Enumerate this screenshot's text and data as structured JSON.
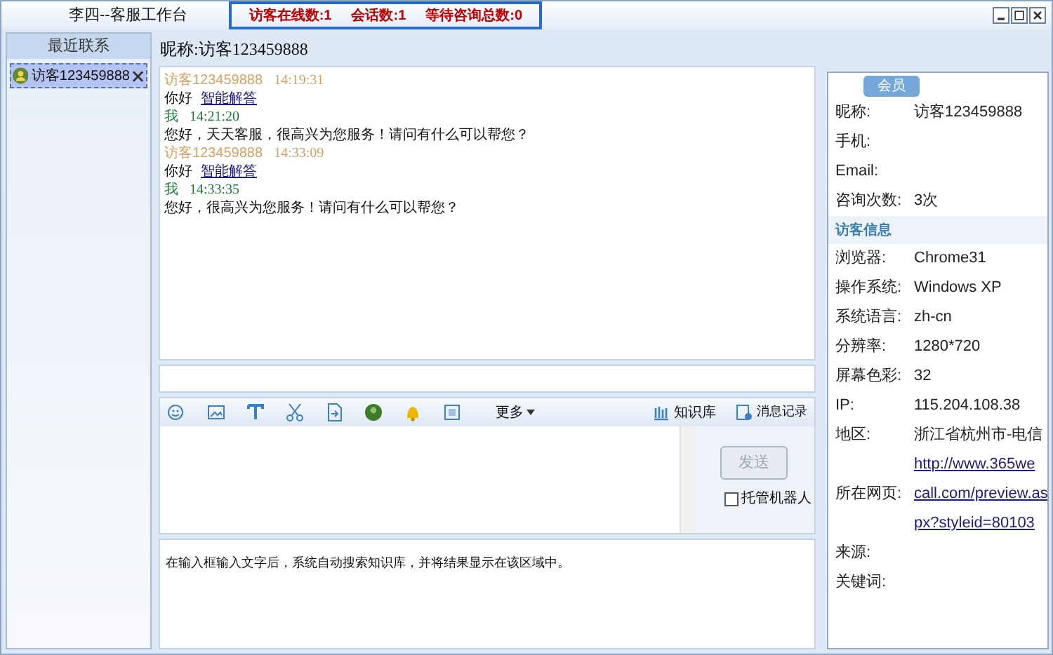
{
  "window": {
    "title": "李四--客服工作台"
  },
  "status": [
    "访客在线数:1",
    "会话数:1",
    "等待咨询总数:0"
  ],
  "sidebar": {
    "header": "最近联系",
    "items": [
      {
        "name": "访客123459888",
        "selected": true
      }
    ]
  },
  "chat": {
    "nickname": "昵称:访客123459888",
    "messages": [
      {
        "kind": "visitor",
        "sender": "访客123459888",
        "time": "14:19:31",
        "text": "你好",
        "link": "智能解答"
      },
      {
        "kind": "agent",
        "sender": "我",
        "time": "14:21:20",
        "text": "您好，天天客服，很高兴为您服务！请问有什么可以帮您？"
      },
      {
        "kind": "visitor",
        "sender": "访客123459888",
        "time": "14:33:09",
        "text": "你好",
        "link": "智能解答"
      },
      {
        "kind": "agent",
        "sender": "我",
        "time": "14:33:35",
        "text": "您好，很高兴为您服务！请问有什么可以帮您？"
      }
    ]
  },
  "toolbar": {
    "more": "更多",
    "knowledge": "知识库",
    "history": "消息记录"
  },
  "send": {
    "label": "发送",
    "disabled": true
  },
  "robot": {
    "label": "托管机器人",
    "checked": false
  },
  "hint": "在输入框输入文字后，系统自动搜索知识库，并将结果显示在该区域中。",
  "info": {
    "badge": "会员",
    "member_rows": [
      {
        "label": "昵称:",
        "value": "访客123459888"
      },
      {
        "label": "手机:"
      },
      {
        "label": "Email:"
      },
      {
        "label": "咨询次数:",
        "value": "3次"
      }
    ],
    "section": "访客信息",
    "visitor_rows": [
      {
        "label": "浏览器:",
        "value": "Chrome31"
      },
      {
        "label": "操作系统:",
        "value": "Windows XP"
      },
      {
        "label": "系统语言:",
        "value": "zh-cn"
      },
      {
        "label": "分辨率:",
        "value": "1280*720"
      },
      {
        "label": "屏幕色彩:",
        "value": "32"
      },
      {
        "label": "IP:",
        "value": "115.204.108.38"
      },
      {
        "label": "地区:",
        "value": "浙江省杭州市-电信"
      },
      {
        "label": "所在网页:",
        "links": [
          "http://www.365we",
          "call.com/preview.as",
          "px?styleid=80103"
        ]
      },
      {
        "label": "来源:"
      },
      {
        "label": "关键词:"
      }
    ]
  }
}
